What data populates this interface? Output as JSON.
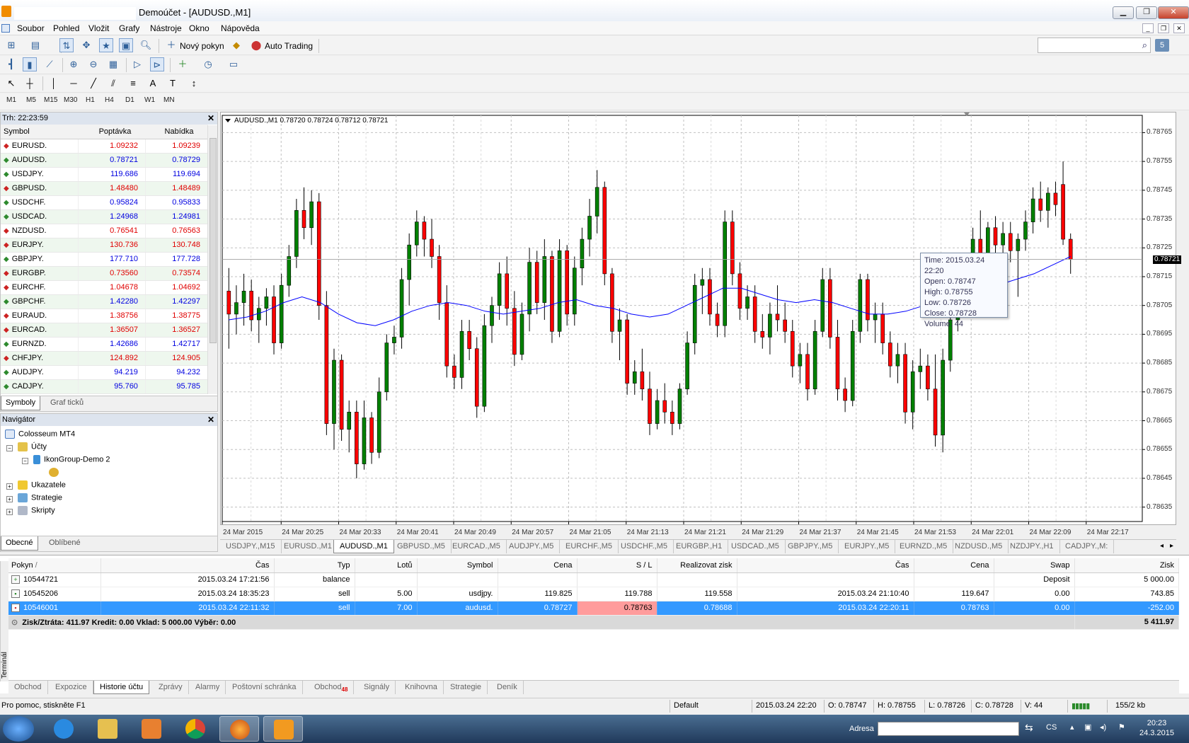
{
  "window": {
    "title": "Demoúčet - [AUDUSD.,M1]"
  },
  "menu": [
    "Soubor",
    "Pohled",
    "Vložit",
    "Grafy",
    "Nástroje",
    "Okno",
    "Nápověda"
  ],
  "toolbar": {
    "new_order": "Nový pokyn",
    "auto_trading": "Auto Trading",
    "mail_count": "5"
  },
  "periods": [
    "M1",
    "M5",
    "M15",
    "M30",
    "H1",
    "H4",
    "D1",
    "W1",
    "MN"
  ],
  "market_watch": {
    "header": "Trh: 22:23:59",
    "col_symbol": "Symbol",
    "col_bid": "Poptávka",
    "col_ask": "Nabídka",
    "rows": [
      {
        "symbol": "EURUSD.",
        "bid": "1.09232",
        "ask": "1.09239",
        "dir": "down"
      },
      {
        "symbol": "AUDUSD.",
        "bid": "0.78721",
        "ask": "0.78729",
        "dir": "up"
      },
      {
        "symbol": "USDJPY.",
        "bid": "119.686",
        "ask": "119.694",
        "dir": "up"
      },
      {
        "symbol": "GBPUSD.",
        "bid": "1.48480",
        "ask": "1.48489",
        "dir": "down"
      },
      {
        "symbol": "USDCHF.",
        "bid": "0.95824",
        "ask": "0.95833",
        "dir": "up"
      },
      {
        "symbol": "USDCAD.",
        "bid": "1.24968",
        "ask": "1.24981",
        "dir": "up"
      },
      {
        "symbol": "NZDUSD.",
        "bid": "0.76541",
        "ask": "0.76563",
        "dir": "down"
      },
      {
        "symbol": "EURJPY.",
        "bid": "130.736",
        "ask": "130.748",
        "dir": "down"
      },
      {
        "symbol": "GBPJPY.",
        "bid": "177.710",
        "ask": "177.728",
        "dir": "up"
      },
      {
        "symbol": "EURGBP.",
        "bid": "0.73560",
        "ask": "0.73574",
        "dir": "down"
      },
      {
        "symbol": "EURCHF.",
        "bid": "1.04678",
        "ask": "1.04692",
        "dir": "down"
      },
      {
        "symbol": "GBPCHF.",
        "bid": "1.42280",
        "ask": "1.42297",
        "dir": "up"
      },
      {
        "symbol": "EURAUD.",
        "bid": "1.38756",
        "ask": "1.38775",
        "dir": "down"
      },
      {
        "symbol": "EURCAD.",
        "bid": "1.36507",
        "ask": "1.36527",
        "dir": "down"
      },
      {
        "symbol": "EURNZD.",
        "bid": "1.42686",
        "ask": "1.42717",
        "dir": "up"
      },
      {
        "symbol": "CHFJPY.",
        "bid": "124.892",
        "ask": "124.905",
        "dir": "down"
      },
      {
        "symbol": "AUDJPY.",
        "bid": "94.219",
        "ask": "94.232",
        "dir": "up"
      },
      {
        "symbol": "CADJPY.",
        "bid": "95.760",
        "ask": "95.785",
        "dir": "up"
      }
    ],
    "tabs": [
      "Symboly",
      "Graf ticků"
    ]
  },
  "navigator": {
    "header": "Navigátor",
    "root": "Colosseum MT4",
    "accounts": "Účty",
    "account_name": "IkonGroup-Demo 2",
    "indicators": "Ukazatele",
    "strategies": "Strategie",
    "scripts": "Skripty",
    "tabs": [
      "Obecné",
      "Oblíbené"
    ]
  },
  "chart": {
    "info": "AUDUSD.,M1  0.78720 0.78724 0.78712 0.78721",
    "current_price": "0.78721",
    "price_labels": [
      "0.78765",
      "0.78755",
      "0.78745",
      "0.78735",
      "0.78725",
      "0.78715",
      "0.78705",
      "0.78695",
      "0.78685",
      "0.78675",
      "0.78665",
      "0.78655",
      "0.78645",
      "0.78635"
    ],
    "time_labels": [
      "24 Mar 2015",
      "24 Mar 20:25",
      "24 Mar 20:33",
      "24 Mar 20:41",
      "24 Mar 20:49",
      "24 Mar 20:57",
      "24 Mar 21:05",
      "24 Mar 21:13",
      "24 Mar 21:21",
      "24 Mar 21:29",
      "24 Mar 21:37",
      "24 Mar 21:45",
      "24 Mar 21:53",
      "24 Mar 22:01",
      "24 Mar 22:09",
      "24 Mar 22:17"
    ],
    "tooltip": {
      "time": "Time: 2015.03.24 22:20",
      "open": "Open: 0.78747",
      "high": "High: 0.78755",
      "low": "Low:  0.78726",
      "close": "Close: 0.78728",
      "volume": "Volume: 44"
    },
    "colors": {
      "bull": "#008000",
      "bear": "#ff0000",
      "ma": "#0000ff",
      "grid": "#c0c0c0"
    }
  },
  "chart_data": {
    "type": "candlestick",
    "ylim": [
      0.7863,
      0.78771
    ],
    "candles": [
      [
        0.7871,
        0.78718,
        0.7869,
        0.78702
      ],
      [
        0.78702,
        0.78712,
        0.78695,
        0.78706
      ],
      [
        0.78706,
        0.78716,
        0.78698,
        0.7871
      ],
      [
        0.7871,
        0.78714,
        0.78696,
        0.787
      ],
      [
        0.787,
        0.78708,
        0.78692,
        0.78704
      ],
      [
        0.78704,
        0.78711,
        0.78698,
        0.78708
      ],
      [
        0.78708,
        0.78712,
        0.78688,
        0.78692
      ],
      [
        0.78692,
        0.78716,
        0.7869,
        0.78712
      ],
      [
        0.78712,
        0.78726,
        0.78708,
        0.78722
      ],
      [
        0.78722,
        0.78742,
        0.78718,
        0.78738
      ],
      [
        0.78738,
        0.78746,
        0.78728,
        0.78732
      ],
      [
        0.78732,
        0.78745,
        0.78726,
        0.78741
      ],
      [
        0.78741,
        0.78744,
        0.787,
        0.78705
      ],
      [
        0.78705,
        0.7871,
        0.7866,
        0.78664
      ],
      [
        0.78664,
        0.7869,
        0.78655,
        0.78686
      ],
      [
        0.78686,
        0.78688,
        0.78658,
        0.78662
      ],
      [
        0.78662,
        0.78672,
        0.78654,
        0.78668
      ],
      [
        0.78668,
        0.78672,
        0.78645,
        0.7865
      ],
      [
        0.7865,
        0.78672,
        0.78648,
        0.78666
      ],
      [
        0.78666,
        0.78668,
        0.7865,
        0.78654
      ],
      [
        0.78654,
        0.7868,
        0.78652,
        0.78675
      ],
      [
        0.78675,
        0.78695,
        0.78672,
        0.78692
      ],
      [
        0.78692,
        0.78698,
        0.78688,
        0.78694
      ],
      [
        0.78694,
        0.78718,
        0.7869,
        0.78714
      ],
      [
        0.78714,
        0.7873,
        0.78705,
        0.78726
      ],
      [
        0.78726,
        0.78738,
        0.78722,
        0.78734
      ],
      [
        0.78734,
        0.78736,
        0.78722,
        0.78728
      ],
      [
        0.78728,
        0.78735,
        0.78718,
        0.78722
      ],
      [
        0.78722,
        0.78726,
        0.787,
        0.78706
      ],
      [
        0.78706,
        0.78712,
        0.7868,
        0.78684
      ],
      [
        0.78684,
        0.78688,
        0.78676,
        0.7868
      ],
      [
        0.7868,
        0.787,
        0.78676,
        0.78696
      ],
      [
        0.78696,
        0.787,
        0.78686,
        0.7869
      ],
      [
        0.7869,
        0.78694,
        0.78666,
        0.7867
      ],
      [
        0.7867,
        0.78702,
        0.78668,
        0.78698
      ],
      [
        0.78698,
        0.78708,
        0.78692,
        0.78705
      ],
      [
        0.78705,
        0.7872,
        0.787,
        0.78716
      ],
      [
        0.78716,
        0.78722,
        0.78698,
        0.78704
      ],
      [
        0.78704,
        0.7871,
        0.78684,
        0.78688
      ],
      [
        0.78688,
        0.78706,
        0.78686,
        0.78702
      ],
      [
        0.78702,
        0.78725,
        0.78696,
        0.7872
      ],
      [
        0.7872,
        0.78724,
        0.78702,
        0.78706
      ],
      [
        0.78706,
        0.78728,
        0.787,
        0.78722
      ],
      [
        0.78722,
        0.78724,
        0.78692,
        0.78696
      ],
      [
        0.78696,
        0.78728,
        0.78694,
        0.78724
      ],
      [
        0.78724,
        0.78726,
        0.78698,
        0.78702
      ],
      [
        0.78702,
        0.78722,
        0.78698,
        0.78718
      ],
      [
        0.78718,
        0.78732,
        0.78712,
        0.78728
      ],
      [
        0.78728,
        0.78742,
        0.78722,
        0.78736
      ],
      [
        0.78736,
        0.78752,
        0.7873,
        0.78746
      ],
      [
        0.78746,
        0.78748,
        0.78712,
        0.78716
      ],
      [
        0.78716,
        0.78718,
        0.78692,
        0.78696
      ],
      [
        0.78696,
        0.78704,
        0.78686,
        0.787
      ],
      [
        0.787,
        0.78702,
        0.78674,
        0.78678
      ],
      [
        0.78678,
        0.78686,
        0.78674,
        0.78682
      ],
      [
        0.78682,
        0.7869,
        0.78672,
        0.78676
      ],
      [
        0.78676,
        0.78682,
        0.7866,
        0.78664
      ],
      [
        0.78664,
        0.78676,
        0.78662,
        0.78672
      ],
      [
        0.78672,
        0.78678,
        0.78664,
        0.78668
      ],
      [
        0.78668,
        0.78672,
        0.7866,
        0.78664
      ],
      [
        0.78664,
        0.78678,
        0.78662,
        0.78676
      ],
      [
        0.78676,
        0.78696,
        0.78674,
        0.78692
      ],
      [
        0.78692,
        0.78716,
        0.78688,
        0.78712
      ],
      [
        0.78712,
        0.78718,
        0.78702,
        0.78714
      ],
      [
        0.78714,
        0.78718,
        0.78698,
        0.78702
      ],
      [
        0.78702,
        0.78706,
        0.78694,
        0.78698
      ],
      [
        0.78698,
        0.78738,
        0.78694,
        0.78734
      ],
      [
        0.78734,
        0.78738,
        0.78712,
        0.78716
      ],
      [
        0.78716,
        0.7872,
        0.787,
        0.78704
      ],
      [
        0.78704,
        0.78712,
        0.787,
        0.78708
      ],
      [
        0.78708,
        0.78712,
        0.78692,
        0.78696
      ],
      [
        0.78696,
        0.78702,
        0.7869,
        0.78694
      ],
      [
        0.78694,
        0.78706,
        0.78688,
        0.78702
      ],
      [
        0.78702,
        0.78712,
        0.78696,
        0.787
      ],
      [
        0.787,
        0.78706,
        0.78692,
        0.78696
      ],
      [
        0.78696,
        0.787,
        0.7868,
        0.78684
      ],
      [
        0.78684,
        0.78692,
        0.78678,
        0.78688
      ],
      [
        0.78688,
        0.78692,
        0.78672,
        0.78676
      ],
      [
        0.78676,
        0.787,
        0.78674,
        0.78696
      ],
      [
        0.78696,
        0.78718,
        0.78694,
        0.78714
      ],
      [
        0.78714,
        0.78718,
        0.7869,
        0.78694
      ],
      [
        0.78694,
        0.787,
        0.78672,
        0.78676
      ],
      [
        0.78676,
        0.7868,
        0.78668,
        0.78672
      ],
      [
        0.78672,
        0.787,
        0.7867,
        0.78696
      ],
      [
        0.78696,
        0.78716,
        0.78692,
        0.78714
      ],
      [
        0.78714,
        0.78716,
        0.78696,
        0.787
      ],
      [
        0.787,
        0.78706,
        0.78692,
        0.78702
      ],
      [
        0.78702,
        0.78706,
        0.78688,
        0.78692
      ],
      [
        0.78692,
        0.78696,
        0.7868,
        0.78684
      ],
      [
        0.78684,
        0.78692,
        0.78678,
        0.78688
      ],
      [
        0.78688,
        0.78692,
        0.78664,
        0.78668
      ],
      [
        0.78668,
        0.78686,
        0.78662,
        0.78682
      ],
      [
        0.78682,
        0.7869,
        0.78676,
        0.78684
      ],
      [
        0.78684,
        0.78688,
        0.78672,
        0.78676
      ],
      [
        0.78676,
        0.78688,
        0.78656,
        0.7866
      ],
      [
        0.7866,
        0.7869,
        0.78654,
        0.78686
      ],
      [
        0.78686,
        0.78704,
        0.78682,
        0.787
      ],
      [
        0.787,
        0.78714,
        0.78696,
        0.7871
      ],
      [
        0.7871,
        0.78722,
        0.78704,
        0.78718
      ],
      [
        0.78718,
        0.78732,
        0.78714,
        0.78728
      ],
      [
        0.78728,
        0.78738,
        0.78718,
        0.78722
      ],
      [
        0.78722,
        0.78734,
        0.78718,
        0.78732
      ],
      [
        0.78732,
        0.78736,
        0.78722,
        0.78726
      ],
      [
        0.78726,
        0.78734,
        0.78722,
        0.7873
      ],
      [
        0.7873,
        0.78734,
        0.7872,
        0.78724
      ],
      [
        0.78724,
        0.7873,
        0.78708,
        0.78728
      ],
      [
        0.78728,
        0.78738,
        0.78724,
        0.78734
      ],
      [
        0.78734,
        0.78746,
        0.7873,
        0.78742
      ],
      [
        0.78742,
        0.78748,
        0.78734,
        0.78738
      ],
      [
        0.78738,
        0.78746,
        0.78732,
        0.78744
      ],
      [
        0.78744,
        0.78748,
        0.78736,
        0.7874
      ],
      [
        0.78747,
        0.78755,
        0.78726,
        0.78728
      ],
      [
        0.78728,
        0.7873,
        0.78716,
        0.78721
      ]
    ],
    "ma": [
      0.787,
      0.78701,
      0.78703,
      0.78706,
      0.78708,
      0.78706,
      0.78702,
      0.78699,
      0.78698,
      0.787,
      0.78703,
      0.78705,
      0.78706,
      0.78705,
      0.78703,
      0.78702,
      0.78703,
      0.78704,
      0.78706,
      0.78707,
      0.78705,
      0.78704,
      0.78702,
      0.78701,
      0.78702,
      0.78705,
      0.78708,
      0.78711,
      0.78711,
      0.78709,
      0.78707,
      0.78706,
      0.78707,
      0.78706,
      0.78704,
      0.78702,
      0.78702,
      0.78703,
      0.78705,
      0.78707,
      0.78708,
      0.78709,
      0.78712,
      0.78714,
      0.78716,
      0.78719,
      0.78722
    ]
  },
  "chart_tabs": [
    "USDJPY.,M15",
    "EURUSD.,M1",
    "AUDUSD.,M1",
    "GBPUSD.,M5",
    "EURCAD.,M5",
    "AUDJPY.,M5",
    "EURCHF.,M5",
    "USDCHF.,M5",
    "EURGBP.,H1",
    "USDCAD.,M5",
    "GBPJPY.,M5",
    "EURJPY.,M5",
    "EURNZD.,M5",
    "NZDUSD.,M5",
    "NZDJPY.,H1",
    "CADJPY.,M:"
  ],
  "terminal": {
    "label": "Terminál",
    "columns": [
      "Pokyn",
      "/",
      "Čas",
      "Typ",
      "Lotů",
      "Symbol",
      "Cena",
      "S / L",
      "Realizovat zisk",
      "Čas",
      "Cena",
      "Swap",
      "Zisk"
    ],
    "rows": [
      {
        "order": "10544721",
        "time": "2015.03.24 17:21:56",
        "type": "balance",
        "lots": "",
        "symbol": "",
        "price": "",
        "sl": "",
        "tp": "",
        "close_time": "",
        "close_price": "",
        "swap": "Deposit",
        "profit": "5 000.00"
      },
      {
        "order": "10545206",
        "time": "2015.03.24 18:35:23",
        "type": "sell",
        "lots": "5.00",
        "symbol": "usdjpy.",
        "price": "119.825",
        "sl": "119.788",
        "tp": "119.558",
        "close_time": "2015.03.24 21:10:40",
        "close_price": "119.647",
        "swap": "0.00",
        "profit": "743.85"
      },
      {
        "order": "10546001",
        "time": "2015.03.24 22:11:32",
        "type": "sell",
        "lots": "7.00",
        "symbol": "audusd.",
        "price": "0.78727",
        "sl": "0.78763",
        "tp": "0.78688",
        "close_time": "2015.03.24 22:20:11",
        "close_price": "0.78763",
        "swap": "0.00",
        "profit": "-252.00"
      }
    ],
    "summary": "Zisk/Ztráta: 411.97  Kredit: 0.00  Vklad: 5 000.00  Výběr: 0.00",
    "summary_total": "5 411.97",
    "tabs": [
      "Obchod",
      "Expozice",
      "Historie účtu",
      "Zprávy",
      "Alarmy",
      "Poštovní schránka",
      "Obchod",
      "Signály",
      "Knihovna",
      "Strategie",
      "Deník"
    ],
    "badge": "48"
  },
  "statusbar": {
    "help": "Pro pomoc, stiskněte F1",
    "profile": "Default",
    "time": "2015.03.24 22:20",
    "open": "O: 0.78747",
    "high": "H: 0.78755",
    "low": "L: 0.78726",
    "close": "C: 0.78728",
    "volume": "V: 44",
    "traffic": "155/2 kb"
  },
  "taskbar": {
    "address_label": "Adresa",
    "lang": "CS",
    "time": "20:23",
    "date": "24.3.2015"
  }
}
